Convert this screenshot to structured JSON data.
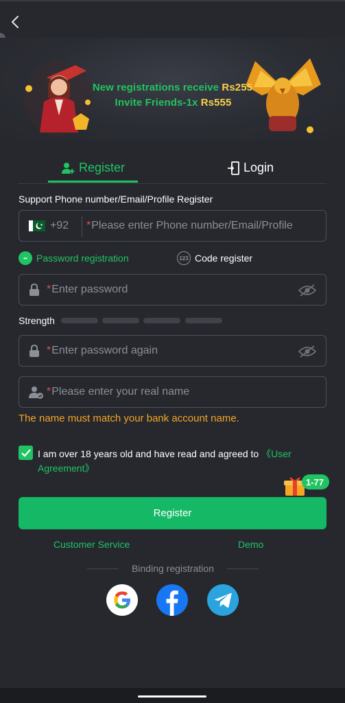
{
  "banner": {
    "promo_line1_text": "New registrations receive",
    "promo_line1_amount": "Rs255",
    "promo_line2_text": "Invite Friends-1x",
    "promo_line2_amount": "Rs555"
  },
  "tabs": {
    "register_label": "Register",
    "login_label": "Login"
  },
  "form": {
    "account_label": "Support Phone number/Email/Profile Register",
    "country_code": "+92",
    "account_placeholder": "Please enter Phone number/Email/Profile",
    "password_registration_label": "Password registration",
    "code_register_label": "Code register",
    "code_icon_text": "123",
    "password_placeholder": "Enter password",
    "strength_label": "Strength",
    "password_again_placeholder": "Enter password again",
    "real_name_placeholder": "Please enter your real name",
    "name_warning": "The name must match your bank account name.",
    "agreement_text": "I am over 18 years old and have read and agreed to ",
    "agreement_link": "《User Agreement》",
    "agreement_checked": true,
    "register_button": "Register"
  },
  "promo_badge": "1-77",
  "links": {
    "customer_service": "Customer Service",
    "demo": "Demo"
  },
  "binding": {
    "label": "Binding registration",
    "providers": [
      "google-icon",
      "facebook-icon",
      "telegram-icon"
    ]
  },
  "colors": {
    "background": "#26282e",
    "accent": "#20c463",
    "button": "#15b865",
    "warning": "#f5a623",
    "required_star": "#e74c4c",
    "highlight": "#f7d14a"
  }
}
